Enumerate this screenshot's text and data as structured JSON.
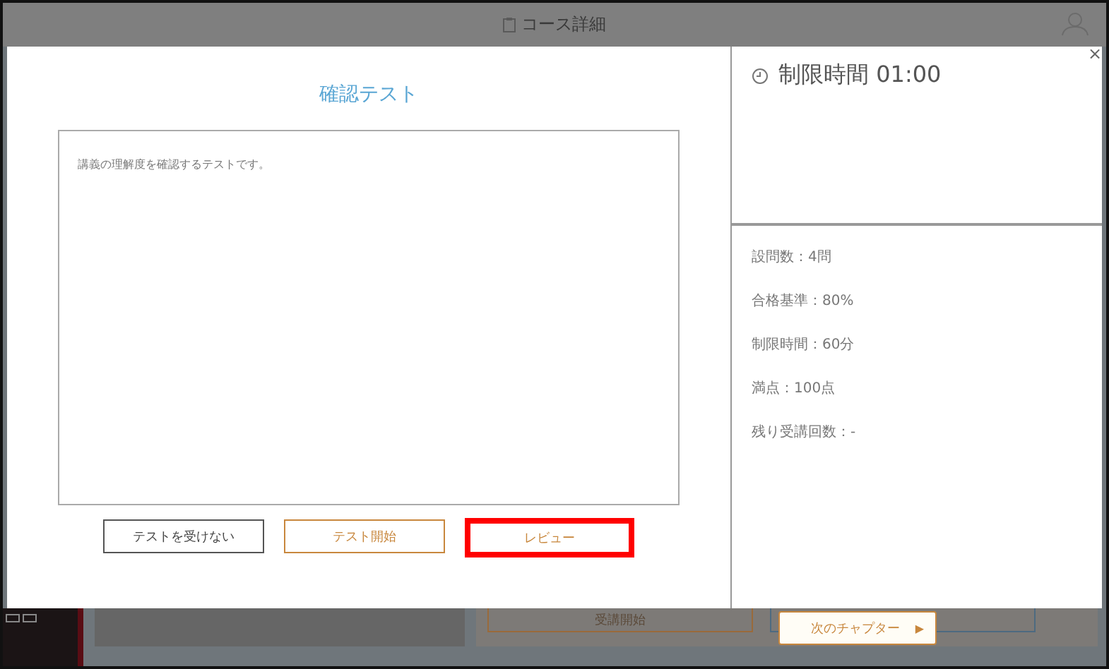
{
  "header": {
    "title": "コース詳細"
  },
  "dialog": {
    "title": "確認テスト",
    "description": "講義の理解度を確認するテストです。",
    "time_limit": "制限時間 01:00",
    "close": "×",
    "info": [
      "設問数：4問",
      "合格基準：80%",
      "制限時間：60分",
      "満点：100点",
      "残り受講回数：-"
    ],
    "buttons": [
      {
        "label": "テストを受けない",
        "kind": "neutral",
        "highlighted": false
      },
      {
        "label": "テスト開始",
        "kind": "primary",
        "highlighted": false
      },
      {
        "label": "レビュー",
        "kind": "primary",
        "highlighted": true
      }
    ]
  },
  "background": {
    "start_button": "受講開始",
    "next_button": "次のチャプター",
    "next_arrow": "▶"
  }
}
